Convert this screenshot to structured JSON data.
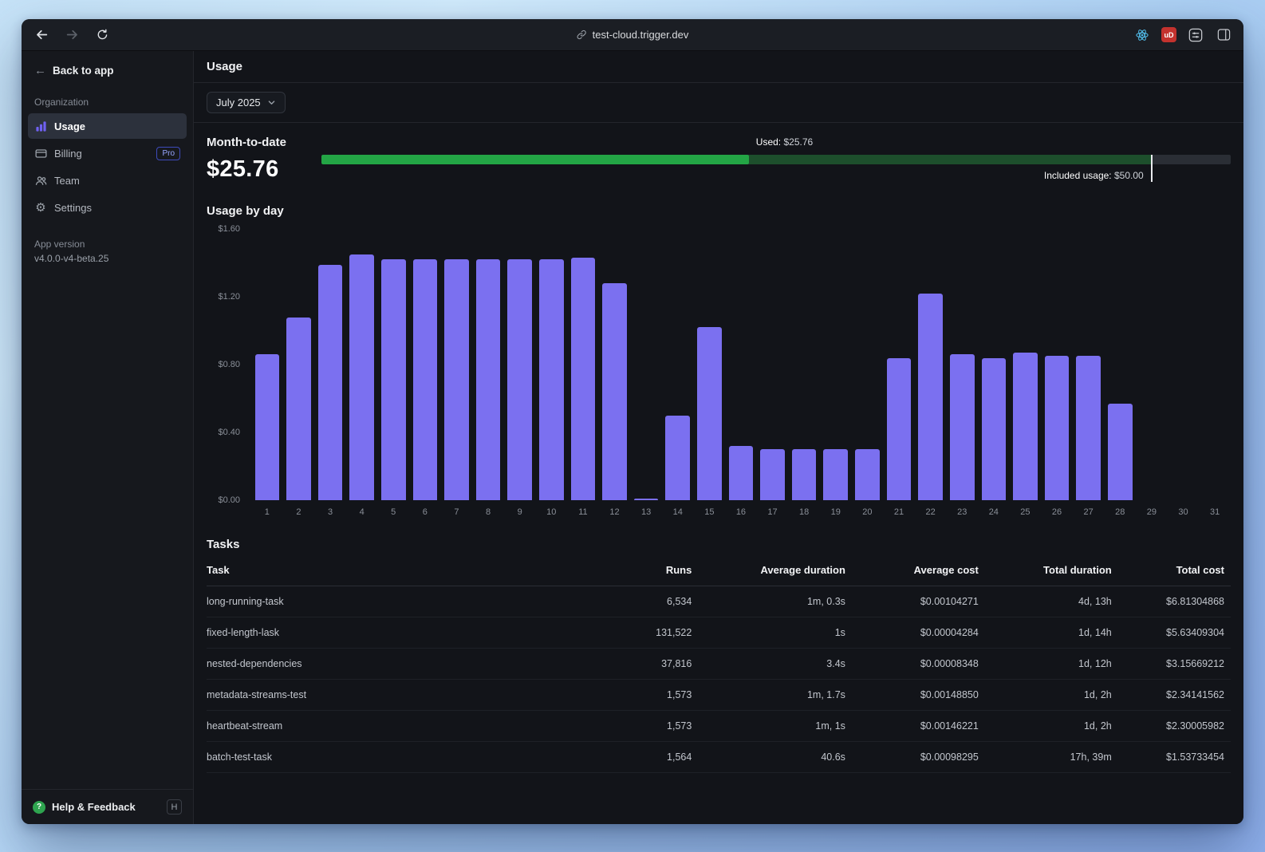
{
  "browser": {
    "url": "test-cloud.trigger.dev",
    "extension_badge": "uD"
  },
  "sidebar": {
    "back_link": "Back to app",
    "section_label": "Organization",
    "items": [
      {
        "label": "Usage",
        "icon": "bar-chart-icon",
        "active": true
      },
      {
        "label": "Billing",
        "icon": "credit-card-icon",
        "badge": "Pro"
      },
      {
        "label": "Team",
        "icon": "people-icon"
      },
      {
        "label": "Settings",
        "icon": "gear-icon"
      }
    ],
    "app_version_label": "App version",
    "app_version": "v4.0.0-v4-beta.25",
    "help": {
      "label": "Help & Feedback",
      "shortcut": "H"
    }
  },
  "header": {
    "title": "Usage"
  },
  "filters": {
    "month_selector": "July 2025"
  },
  "month_to_date": {
    "label": "Month-to-date",
    "amount": "$25.76",
    "used_label": "Used:",
    "used_value": "$25.76",
    "included_label": "Included usage:",
    "included_value": "$50.00",
    "used_percent": 47,
    "included_percent": 91.2,
    "used_color": "#23a545",
    "included_color": "#1d4f2c",
    "track_color": "#2a2e35"
  },
  "chart_section": {
    "title": "Usage by day"
  },
  "chart_data": {
    "type": "bar",
    "title": "Usage by day",
    "categories": [
      "1",
      "2",
      "3",
      "4",
      "5",
      "6",
      "7",
      "8",
      "9",
      "10",
      "11",
      "12",
      "13",
      "14",
      "15",
      "16",
      "17",
      "18",
      "19",
      "20",
      "21",
      "22",
      "23",
      "24",
      "25",
      "26",
      "27",
      "28",
      "29",
      "30",
      "31"
    ],
    "values": [
      0.86,
      1.08,
      1.39,
      1.45,
      1.42,
      1.42,
      1.42,
      1.42,
      1.42,
      1.42,
      1.43,
      1.28,
      0.01,
      0.5,
      1.02,
      0.32,
      0.3,
      0.3,
      0.3,
      0.3,
      0.84,
      1.22,
      0.86,
      0.84,
      0.87,
      0.85,
      0.85,
      0.57,
      0,
      0,
      0
    ],
    "xlabel": "",
    "ylabel": "",
    "ylim": [
      0,
      1.6
    ],
    "y_ticks": [
      {
        "label": "$0.00",
        "value": 0.0
      },
      {
        "label": "$0.40",
        "value": 0.4
      },
      {
        "label": "$0.80",
        "value": 0.8
      },
      {
        "label": "$1.20",
        "value": 1.2
      },
      {
        "label": "$1.60",
        "value": 1.6
      }
    ],
    "grid": false,
    "legend": false,
    "bar_color": "#7b70f0"
  },
  "tasks": {
    "title": "Tasks",
    "columns": [
      "Task",
      "Runs",
      "Average duration",
      "Average cost",
      "Total duration",
      "Total cost"
    ],
    "rows": [
      [
        "long-running-task",
        "6,534",
        "1m, 0.3s",
        "$0.00104271",
        "4d, 13h",
        "$6.81304868"
      ],
      [
        "fixed-length-lask",
        "131,522",
        "1s",
        "$0.00004284",
        "1d, 14h",
        "$5.63409304"
      ],
      [
        "nested-dependencies",
        "37,816",
        "3.4s",
        "$0.00008348",
        "1d, 12h",
        "$3.15669212"
      ],
      [
        "metadata-streams-test",
        "1,573",
        "1m, 1.7s",
        "$0.00148850",
        "1d, 2h",
        "$2.34141562"
      ],
      [
        "heartbeat-stream",
        "1,573",
        "1m, 1s",
        "$0.00146221",
        "1d, 2h",
        "$2.30005982"
      ],
      [
        "batch-test-task",
        "1,564",
        "40.6s",
        "$0.00098295",
        "17h, 39m",
        "$1.53733454"
      ]
    ]
  },
  "colors": {
    "accent_purple": "#7b70f0",
    "progress_green": "#23a545",
    "window_bg": "#121419",
    "sidebar_bg": "#16181d",
    "topbar_bg": "#1b1e24"
  }
}
